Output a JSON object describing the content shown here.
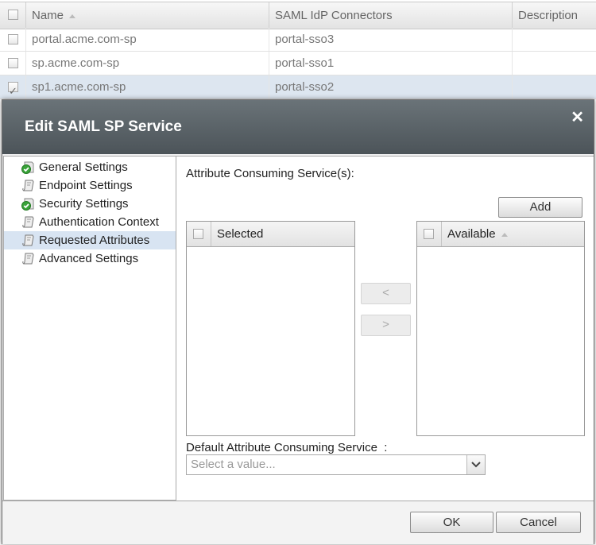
{
  "table": {
    "columns": [
      "Name",
      "SAML IdP Connectors",
      "Description"
    ],
    "rows": [
      {
        "name": "portal.acme.com-sp",
        "connector": "portal-sso3",
        "checked": false
      },
      {
        "name": "sp.acme.com-sp",
        "connector": "portal-sso1",
        "checked": false
      },
      {
        "name": "sp1.acme.com-sp",
        "connector": "portal-sso2",
        "checked": true
      }
    ]
  },
  "dialog": {
    "title": "Edit SAML SP Service",
    "close_glyph": "✕",
    "nav": [
      {
        "label": "General Settings",
        "icon": "green-check-icon"
      },
      {
        "label": "Endpoint Settings",
        "icon": "scroll-icon"
      },
      {
        "label": "Security Settings",
        "icon": "green-check-icon"
      },
      {
        "label": "Authentication Context",
        "icon": "scroll-icon"
      },
      {
        "label": "Requested Attributes",
        "icon": "scroll-icon",
        "active": true
      },
      {
        "label": "Advanced Settings",
        "icon": "scroll-icon"
      }
    ],
    "acs_label": "Attribute Consuming Service(s):",
    "add_label": "Add",
    "selected_header": "Selected",
    "available_header": "Available",
    "move_left": "<",
    "move_right": ">",
    "default_acs_label": "Default Attribute Consuming Service",
    "default_acs_colon": ":",
    "default_acs_placeholder": "Select a value...",
    "ok_label": "OK",
    "cancel_label": "Cancel"
  },
  "colors": {
    "titlebar": "#59626a",
    "active_nav": "#d8e4f2",
    "selected_row": "#dde6f0"
  }
}
